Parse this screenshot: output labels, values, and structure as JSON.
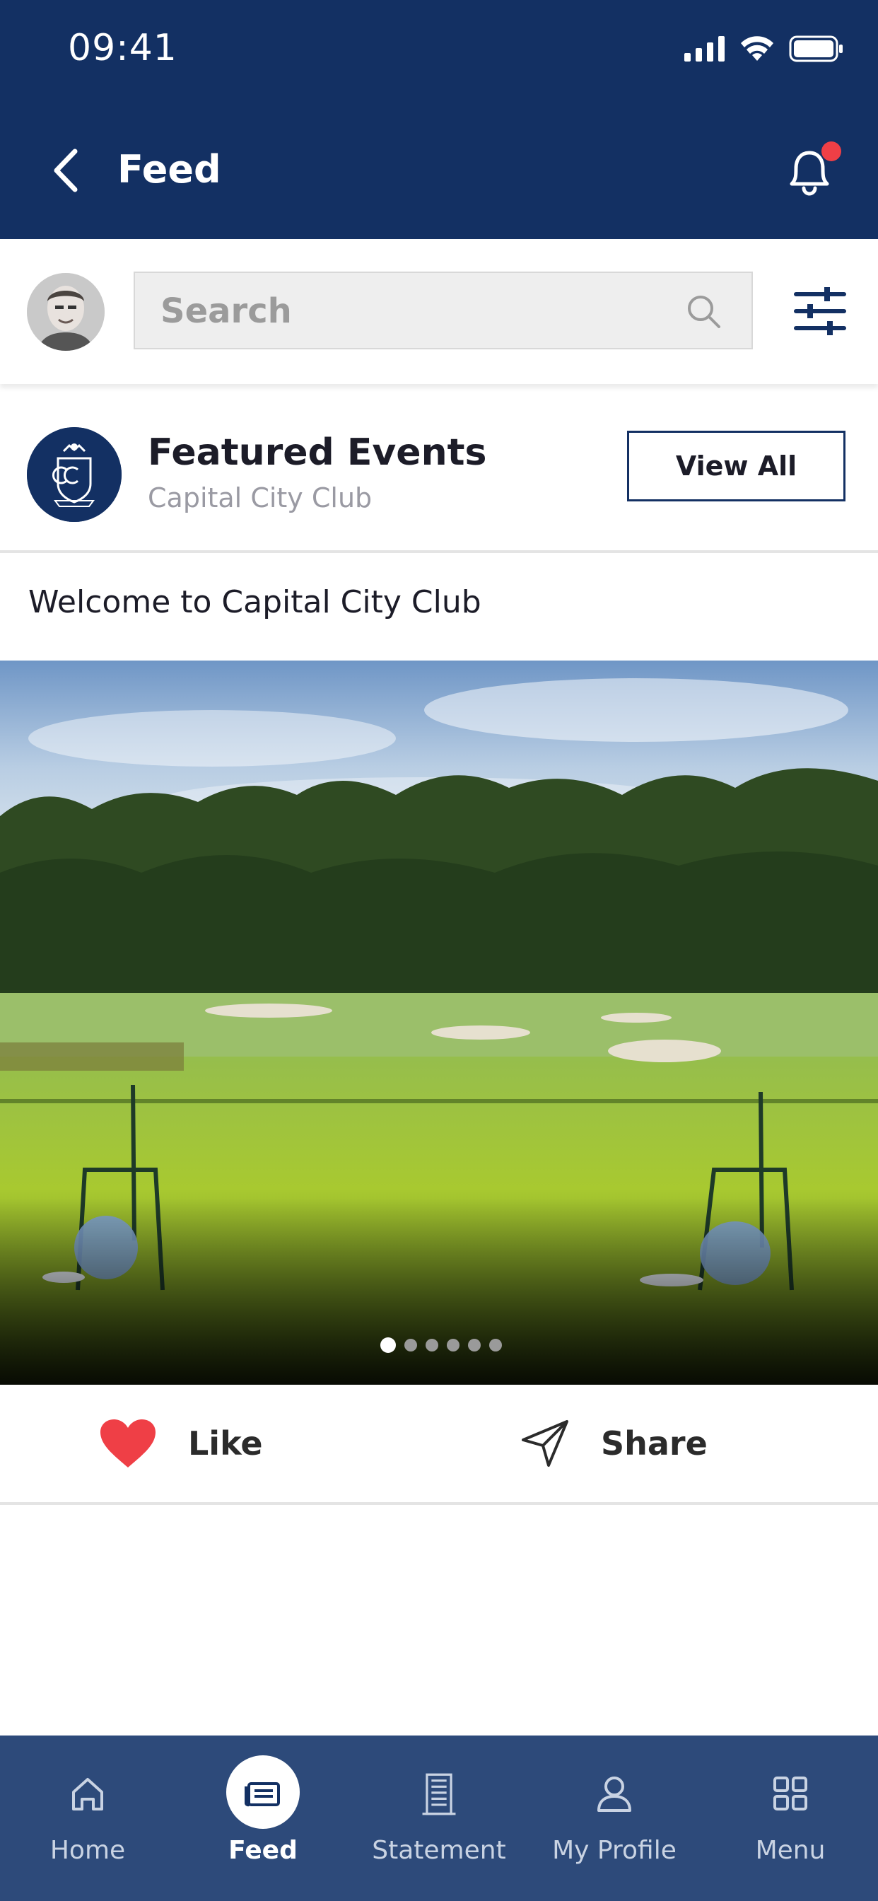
{
  "status_bar": {
    "time": "09:41"
  },
  "header": {
    "title": "Feed"
  },
  "search": {
    "placeholder": "Search"
  },
  "featured": {
    "title": "Featured Events",
    "subtitle": "Capital City Club",
    "view_all_label": "View All"
  },
  "post": {
    "text": "Welcome to Capital City Club",
    "carousel": {
      "total": 6,
      "active_index": 0
    },
    "like_label": "Like",
    "share_label": "Share"
  },
  "tabs": [
    {
      "label": "Home",
      "icon": "home-icon"
    },
    {
      "label": "Feed",
      "icon": "feed-icon",
      "active": true
    },
    {
      "label": "Statement",
      "icon": "statement-icon"
    },
    {
      "label": "My Profile",
      "icon": "profile-icon"
    },
    {
      "label": "Menu",
      "icon": "menu-grid-icon"
    }
  ],
  "colors": {
    "header_bg": "#133063",
    "tabbar_bg": "#2d4a7a",
    "like_heart": "#ef3f46",
    "notification_dot": "#ef3f46"
  }
}
